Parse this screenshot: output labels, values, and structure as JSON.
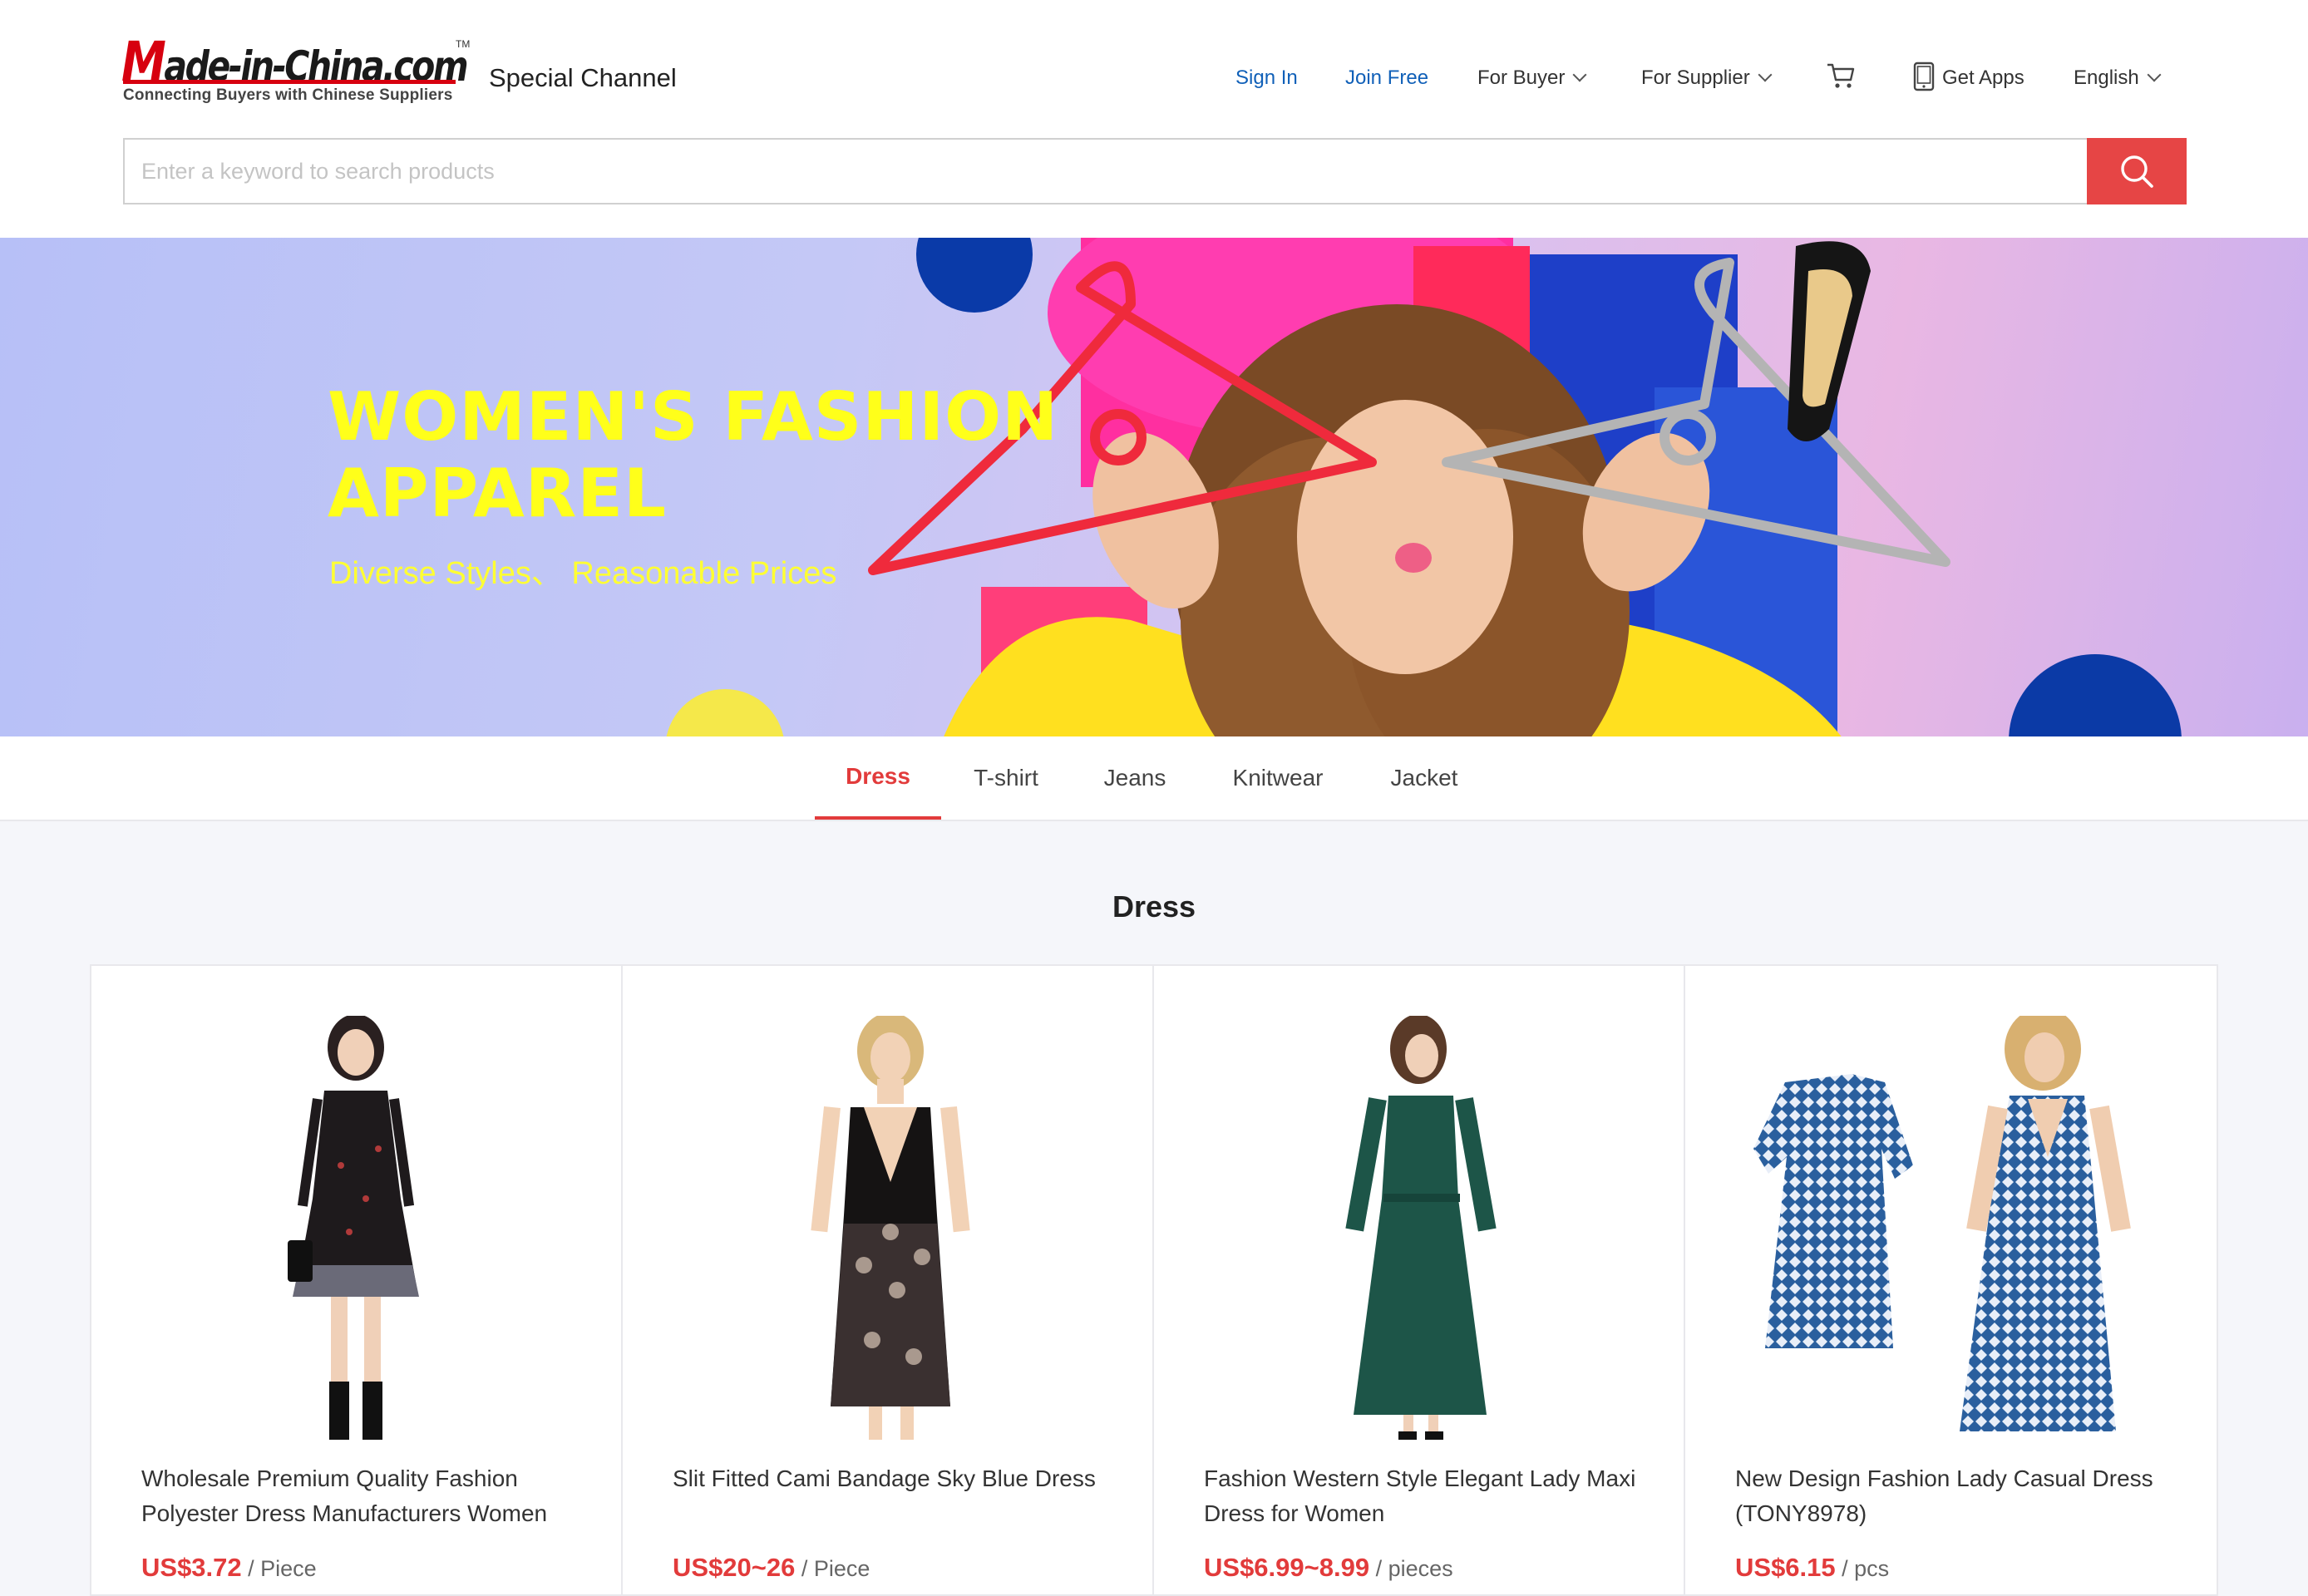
{
  "header": {
    "logo_text_brand": "Made-in-China.com",
    "logo_tm": "TM",
    "logo_tagline": "Connecting Buyers with Chinese Suppliers",
    "channel": "Special Channel",
    "nav": {
      "sign_in": "Sign In",
      "join_free": "Join Free",
      "for_buyer": "For Buyer",
      "for_supplier": "For Supplier",
      "get_apps": "Get Apps",
      "language": "English"
    }
  },
  "search": {
    "placeholder": "Enter a keyword to search products",
    "value": ""
  },
  "banner": {
    "title_line1": "WOMEN'S FASHION",
    "title_line2": "APPAREL",
    "subtitle": "Diverse Styles、 Reasonable Prices"
  },
  "tabs": [
    {
      "label": "Dress",
      "active": true
    },
    {
      "label": "T-shirt",
      "active": false
    },
    {
      "label": "Jeans",
      "active": false
    },
    {
      "label": "Knitwear",
      "active": false
    },
    {
      "label": "Jacket",
      "active": false
    }
  ],
  "section_title": "Dress",
  "products": [
    {
      "name": "Wholesale Premium Quality Fashion Polyester Dress Manufacturers Women",
      "price": "US$3.72",
      "unit": "/ Piece",
      "dress_color": "#1e1a1c"
    },
    {
      "name": "Slit Fitted Cami Bandage Sky Blue Dress",
      "price": "US$20~26",
      "unit": "/ Piece",
      "dress_color": "#151313"
    },
    {
      "name": "Fashion Western Style Elegant Lady Maxi Dress for Women",
      "price": "US$6.99~8.99",
      "unit": "/ pieces",
      "dress_color": "#1d5548"
    },
    {
      "name": "New Design Fashion Lady Casual Dress (TONY8978)",
      "price": "US$6.15",
      "unit": "/ pcs",
      "dress_color": "#2a5f9e"
    }
  ],
  "colors": {
    "accent_red": "#e23b3b",
    "link_blue": "#1060b8",
    "banner_yellow": "#ffff1a"
  }
}
